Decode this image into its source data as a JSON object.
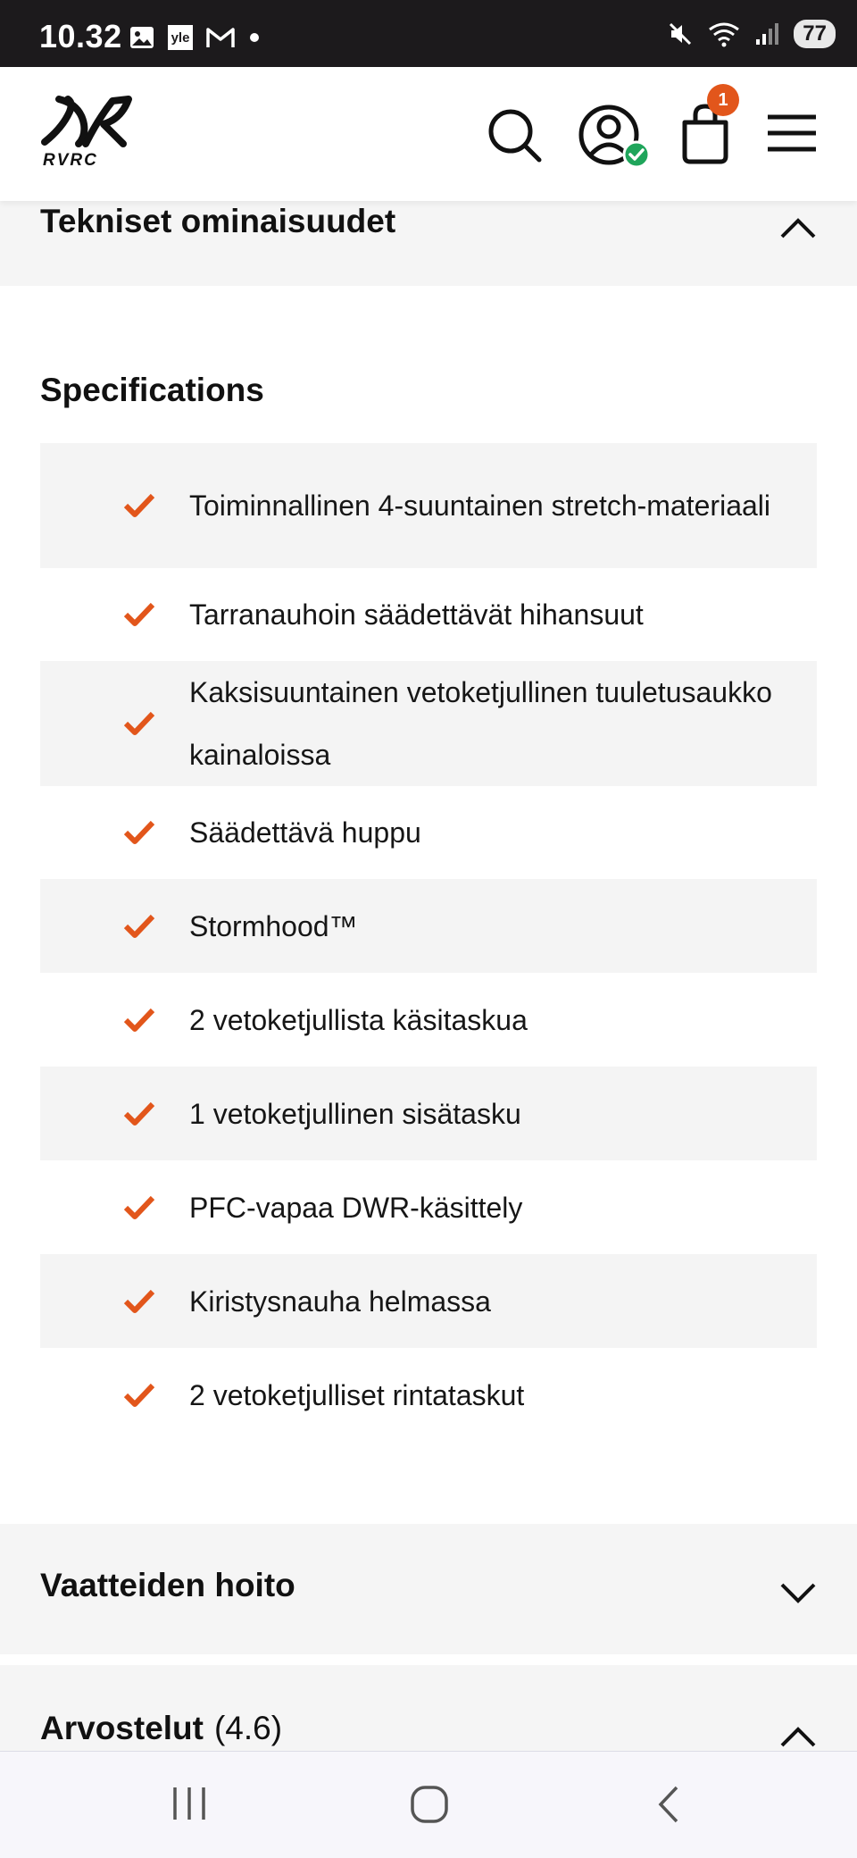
{
  "status_bar": {
    "time": "10.32",
    "battery": "77",
    "yle_label": "yle",
    "left_icons": [
      "gallery-icon",
      "yle-icon",
      "gmail-icon",
      "dot-icon"
    ],
    "right_icons": [
      "mute-icon",
      "wifi-icon",
      "signal-icon",
      "battery-icon"
    ]
  },
  "header": {
    "logo_text": "RVRC",
    "cart_count": "1",
    "accent_color": "#e2561b",
    "verified_color": "#1fa55b"
  },
  "sections": {
    "technical": {
      "title": "Tekniset ominaisuudet",
      "expanded": true
    },
    "care": {
      "title": "Vaatteiden hoito",
      "expanded": false
    },
    "reviews": {
      "title": "Arvostelut",
      "rating": "(4.6)",
      "expanded": true
    }
  },
  "specifications": {
    "heading": "Specifications",
    "items": [
      "Toiminnallinen 4-suuntainen stretch-materiaali",
      "Tarranauhoin säädettävät hihansuut",
      "Kaksisuuntainen vetoketjullinen tuuletusaukko kainaloissa",
      "Säädettävä huppu",
      "Stormhood™",
      "2 vetoketjullista käsitaskua",
      "1 vetoketjullinen sisätasku",
      "PFC-vapaa DWR-käsittely",
      "Kiristysnauha helmassa",
      "2 vetoketjulliset rintataskut"
    ]
  },
  "nav_bar": {
    "buttons": [
      "recent-apps-icon",
      "home-icon",
      "back-icon"
    ]
  }
}
